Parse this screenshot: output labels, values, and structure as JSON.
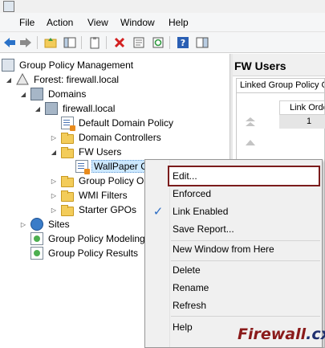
{
  "menubar": {
    "file": "File",
    "action": "Action",
    "view": "View",
    "window": "Window",
    "help": "Help"
  },
  "toolbar_icons": [
    "back-arrow-icon",
    "forward-arrow-icon",
    "up-folder-icon",
    "show-hide-tree-icon",
    "clipboard-icon",
    "delete-icon",
    "properties-icon",
    "refresh-icon",
    "help-icon",
    "console-pane-icon"
  ],
  "tree": {
    "root": "Group Policy Management",
    "forest": "Forest: firewall.local",
    "domains": "Domains",
    "domain": "firewall.local",
    "default_policy": "Default Domain Policy",
    "domain_controllers": "Domain Controllers",
    "fw_users": "FW Users",
    "wallpaper_gpo": "WallPaper GPO",
    "gpo_objects": "Group Policy O",
    "wmi_filters": "WMI Filters",
    "starter_gpos": "Starter GPOs",
    "sites": "Sites",
    "modeling": "Group Policy Modeling",
    "results": "Group Policy Results"
  },
  "right_pane": {
    "title": "FW Users",
    "tab": "Linked Group Policy O",
    "column_header": "Link Orde",
    "row_value": "1"
  },
  "context_menu": {
    "edit": "Edit...",
    "enforced": "Enforced",
    "link_enabled": "Link Enabled",
    "link_enabled_checked": true,
    "save_report": "Save Report...",
    "new_window": "New Window from Here",
    "delete": "Delete",
    "rename": "Rename",
    "refresh": "Refresh",
    "help": "Help"
  },
  "watermark": {
    "part1": "Firewall",
    "part2": ".cx"
  },
  "colors": {
    "highlight_border": "#7b1c1c",
    "selection_bg": "#cce8ff",
    "check_blue": "#2b6cc4"
  }
}
